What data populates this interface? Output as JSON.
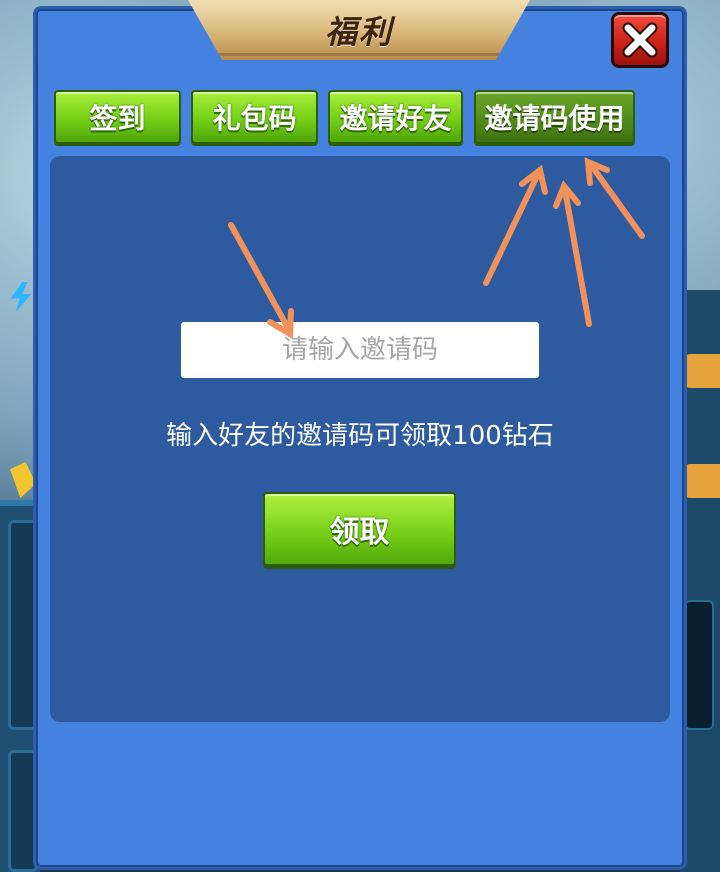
{
  "dialog": {
    "title": "福利",
    "close_icon": "close-x-icon"
  },
  "tabs": [
    {
      "label": "签到",
      "active": false
    },
    {
      "label": "礼包码",
      "active": false
    },
    {
      "label": "邀请好友",
      "active": false
    },
    {
      "label": "邀请码使用",
      "active": true
    }
  ],
  "invite": {
    "input_value": "",
    "input_placeholder": "请输入邀请码",
    "hint": "输入好友的邀请码可领取100钻石",
    "claim_label": "领取"
  },
  "colors": {
    "dialog_bg": "#4582e0",
    "panel_bg": "#2e5aa0",
    "tab_green": "#74cf15",
    "tab_active": "#4f8a18",
    "annotation_arrow": "#f2925a"
  },
  "annotation_icons": [
    "arrow-icon"
  ]
}
